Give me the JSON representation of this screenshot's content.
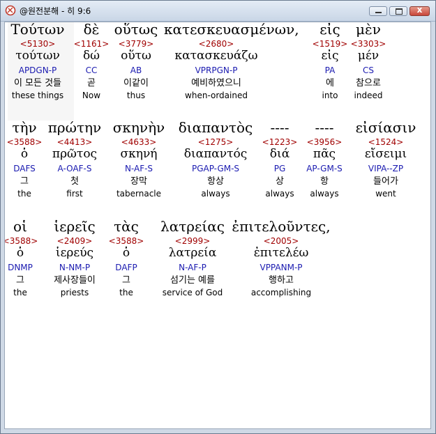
{
  "window": {
    "title": "@원전분해 - 히 9:6",
    "close_label": "x"
  },
  "rows": [
    [
      {
        "greek": "Τούτων",
        "strong": "<5130>",
        "lemma": "τούτων",
        "parse": "APDGN-P",
        "korean": "이 모든 것들",
        "english": "these things"
      },
      {
        "greek": "δὲ",
        "strong": "<1161>",
        "lemma": "δώ",
        "parse": "CC",
        "korean": "곧",
        "english": "Now"
      },
      {
        "greek": "οὕτως",
        "strong": "<3779>",
        "lemma": "οὕτω",
        "parse": "AB",
        "korean": "이같이",
        "english": "thus"
      },
      {
        "greek": "κατεσκευασμένων,",
        "strong": "<2680>",
        "lemma": "κατασκευάζω",
        "parse": "VPRPGN-P",
        "korean": "예비하였으니",
        "english": "when-ordained"
      },
      {
        "greek": "εἰς",
        "strong": "<1519>",
        "lemma": "εἰς",
        "parse": "PA",
        "korean": "에",
        "english": "into"
      },
      {
        "greek": "μὲν",
        "strong": "<3303>",
        "lemma": "μέν",
        "parse": "CS",
        "korean": "참으로",
        "english": "indeed"
      }
    ],
    [
      {
        "greek": "τὴν",
        "strong": "<3588>",
        "lemma": "ὁ",
        "parse": "DAFS",
        "korean": "그",
        "english": "the"
      },
      {
        "greek": "πρώτην",
        "strong": "<4413>",
        "lemma": "πρῶτος",
        "parse": "A-OAF-S",
        "korean": "첫",
        "english": "first"
      },
      {
        "greek": "σκηνὴν",
        "strong": "<4633>",
        "lemma": "σκηνή",
        "parse": "N-AF-S",
        "korean": "장막",
        "english": "tabernacle"
      },
      {
        "greek": "διαπαντὸς",
        "strong": "<1275>",
        "lemma": "διαπαντός",
        "parse": "PGAP-GM-S",
        "korean": "항상",
        "english": "always"
      },
      {
        "greek": "----",
        "strong": "<1223>",
        "lemma": "διά",
        "parse": "PG",
        "korean": "상",
        "english": "always"
      },
      {
        "greek": "----",
        "strong": "<3956>",
        "lemma": "πᾶς",
        "parse": "AP-GM-S",
        "korean": "항",
        "english": "always"
      },
      {
        "greek": "εἰσίασιν",
        "strong": "<1524>",
        "lemma": "εἴσειμι",
        "parse": "VIPA--ZP",
        "korean": "들어가",
        "english": "went"
      }
    ],
    [
      {
        "greek": "οἱ",
        "strong": "<3588>",
        "lemma": "ὁ",
        "parse": "DNMP",
        "korean": "그",
        "english": "the"
      },
      {
        "greek": "ἱερεῖς",
        "strong": "<2409>",
        "lemma": "ἱερεύς",
        "parse": "N-NM-P",
        "korean": "제사장들이",
        "english": "priests"
      },
      {
        "greek": "τὰς",
        "strong": "<3588>",
        "lemma": "ὁ",
        "parse": "DAFP",
        "korean": "그",
        "english": "the"
      },
      {
        "greek": "λατρείας",
        "strong": "<2999>",
        "lemma": "λατρεία",
        "parse": "N-AF-P",
        "korean": "섬기는 예를",
        "english": "service of God"
      },
      {
        "greek": "ἐπιτελοῦντες,",
        "strong": "<2005>",
        "lemma": "ἐπιτελέω",
        "parse": "VPPANM-P",
        "korean": "행하고",
        "english": "accomplishing"
      }
    ]
  ]
}
